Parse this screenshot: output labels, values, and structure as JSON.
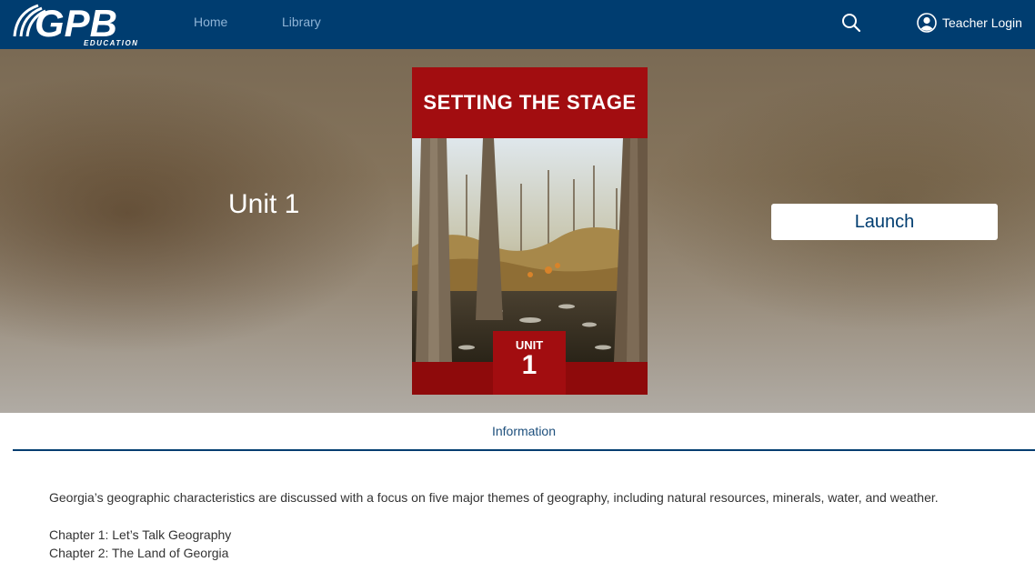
{
  "nav": {
    "logo_text": "GPB",
    "logo_subtext": "EDUCATION",
    "links": [
      "Home",
      "Library"
    ],
    "login_label": "Teacher Login"
  },
  "hero": {
    "unit_title": "Unit 1",
    "launch_label": "Launch",
    "cover": {
      "title": "SETTING THE STAGE",
      "badge_label": "UNIT",
      "badge_number": "1"
    }
  },
  "tabs": [
    "Information"
  ],
  "content": {
    "description": "Georgia’s geographic characteristics are discussed with a focus on five major themes of geography, including natural resources, minerals, water, and weather.",
    "chapters": [
      "Chapter 1: Let’s Talk Geography",
      "Chapter 2: The Land of Georgia"
    ]
  },
  "colors": {
    "nav_bg": "#003d70",
    "nav_link": "#8fb4d6",
    "cover_red": "#a20d10",
    "tab_line": "#003d70"
  }
}
